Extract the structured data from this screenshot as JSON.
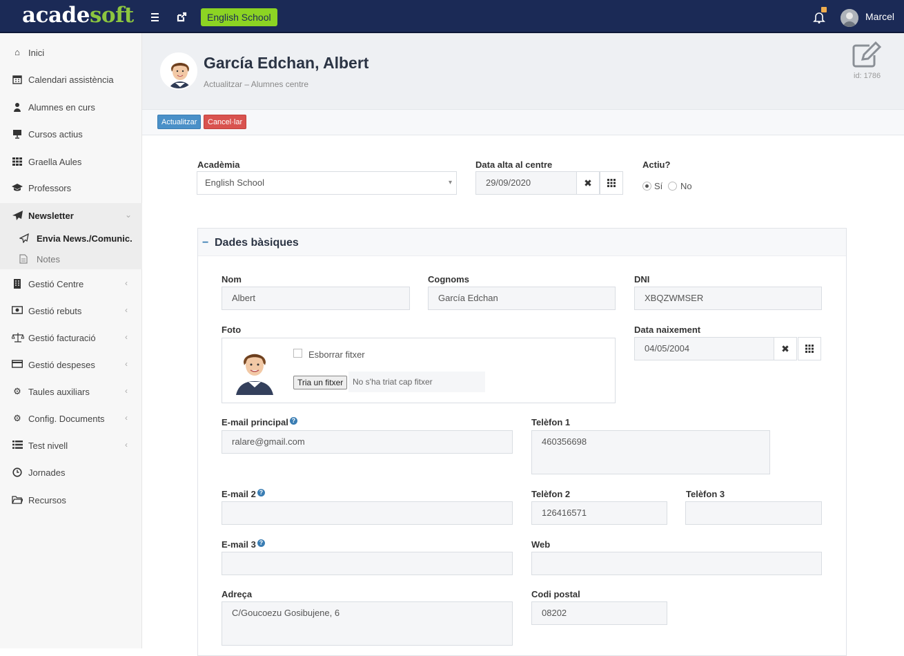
{
  "topbar": {
    "logo_part1": "acade",
    "logo_part2": "soft",
    "school": "English School",
    "user_name": "Marcel"
  },
  "sidebar": {
    "items": [
      {
        "label": "Inici",
        "icon": "home-icon"
      },
      {
        "label": "Calendari assistència",
        "icon": "calendar-icon"
      },
      {
        "label": "Alumnes en curs",
        "icon": "user-icon"
      },
      {
        "label": "Cursos actius",
        "icon": "presentation-icon"
      },
      {
        "label": "Graella Aules",
        "icon": "grid-icon"
      },
      {
        "label": "Professors",
        "icon": "graduation-cap-icon"
      },
      {
        "label": "Newsletter",
        "icon": "paper-plane-icon"
      },
      {
        "label": "Gestió Centre",
        "icon": "building-icon"
      },
      {
        "label": "Gestió rebuts",
        "icon": "money-icon"
      },
      {
        "label": "Gestió facturació",
        "icon": "balance-scale-icon"
      },
      {
        "label": "Gestió despeses",
        "icon": "credit-card-icon"
      },
      {
        "label": "Taules auxiliars",
        "icon": "gear-icon"
      },
      {
        "label": "Config. Documents",
        "icon": "gear-icon"
      },
      {
        "label": "Test nivell",
        "icon": "list-icon"
      },
      {
        "label": "Jornades",
        "icon": "clock-icon"
      },
      {
        "label": "Recursos",
        "icon": "folder-icon"
      }
    ],
    "subitems": [
      {
        "label": "Envia News./Comunic.",
        "icon": "paper-plane-outline-icon"
      },
      {
        "label": "Notes",
        "icon": "file-icon"
      }
    ]
  },
  "header": {
    "title": "García Edchan, Albert",
    "subtitle": "Actualitzar – Alumnes centre",
    "record_id": "id: 1786"
  },
  "actions": {
    "update": "Actualitzar",
    "cancel": "Cancel·lar"
  },
  "top_form": {
    "academy_label": "Acadèmia",
    "academy_value": "English School",
    "date_label": "Data alta al centre",
    "date_value": "29/09/2020",
    "active_label": "Actiu?",
    "active_yes": "Sí",
    "active_no": "No",
    "active_selected": "Sí"
  },
  "panel": {
    "title": "Dades bàsiques",
    "collapse_symbol": "−",
    "nom_label": "Nom",
    "nom_value": "Albert",
    "cognoms_label": "Cognoms",
    "cognoms_value": "García Edchan",
    "dni_label": "DNI",
    "dni_value": "XBQZWMSER",
    "foto_label": "Foto",
    "delete_file_label": "Esborrar fitxer",
    "file_button": "Tria un fitxer",
    "file_status": "No s'ha triat cap fitxer",
    "birth_label": "Data naixement",
    "birth_value": "04/05/2004",
    "email1_label": "E-mail principal",
    "email1_value": "ralare@gmail.com",
    "tel1_label": "Telèfon 1",
    "tel1_value": "460356698",
    "email2_label": "E-mail 2",
    "email2_value": "",
    "tel2_label": "Telèfon 2",
    "tel2_value": "126416571",
    "tel3_label": "Telèfon 3",
    "tel3_value": "",
    "email3_label": "E-mail 3",
    "email3_value": "",
    "web_label": "Web",
    "web_value": "",
    "address_label": "Adreça",
    "address_value": "C/Goucoezu Gosibujene, 6",
    "postal_label": "Codi postal",
    "postal_value": "08202",
    "help_symbol": "?"
  },
  "colors": {
    "topbar": "#1b2a56",
    "accent_green": "#8cd423",
    "update_button": "#4a90c8",
    "cancel_button": "#d9534f"
  }
}
